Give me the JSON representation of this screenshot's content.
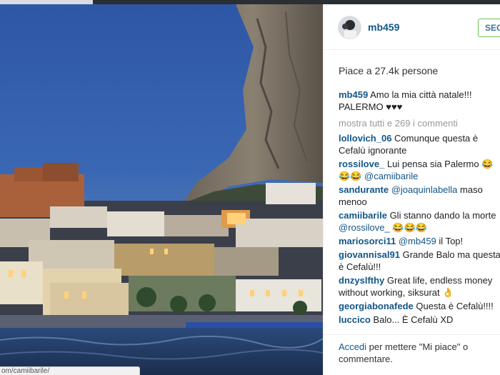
{
  "post": {
    "username": "mb459",
    "follow_label": "SEGUI",
    "likes_text": "Piace a 27.4k persone",
    "caption_user": "mb459",
    "caption_text": "Amo la mia città natale!!! PALERMO ♥♥♥",
    "more_comments": "mostra tutti e 269 i commenti"
  },
  "comments": [
    {
      "user": "lollovich_06",
      "text": "Comunque questa è Cefalù ignorante",
      "mention": ""
    },
    {
      "user": "rossilove_",
      "text": "Lui pensa sia Palermo 😂😂😂",
      "mention": "@camiibarile"
    },
    {
      "user": "sandurante",
      "mention": "@joaquinlabella",
      "text": "maso menoo"
    },
    {
      "user": "camiibarile",
      "text": "Gli stanno dando la morte",
      "mention": "@rossilove_ 😂😂😂"
    },
    {
      "user": "mariosorci11",
      "mention": "@mb459",
      "text": "il Top!"
    },
    {
      "user": "giovannisal91",
      "text": "Grande Balo ma questa è Cefalù!!!",
      "mention": ""
    },
    {
      "user": "dnzyslfthy",
      "text": "Great life, endless money without working, siksurat 👌",
      "mention": ""
    },
    {
      "user": "georgiabonafede",
      "text": "Questa è Cefalù!!!!",
      "mention": ""
    },
    {
      "user": "luccico",
      "text": "Balo... È Cefalù XD",
      "mention": ""
    }
  ],
  "footer": {
    "login_link": "Accedi",
    "login_text": "per mettere \"Mi piace\" o commentare."
  },
  "browser": {
    "status_url": "om/camiibarile/"
  },
  "colors": {
    "link": "#125688",
    "sky": "#3a67b3",
    "follow_border": "#70c050"
  }
}
